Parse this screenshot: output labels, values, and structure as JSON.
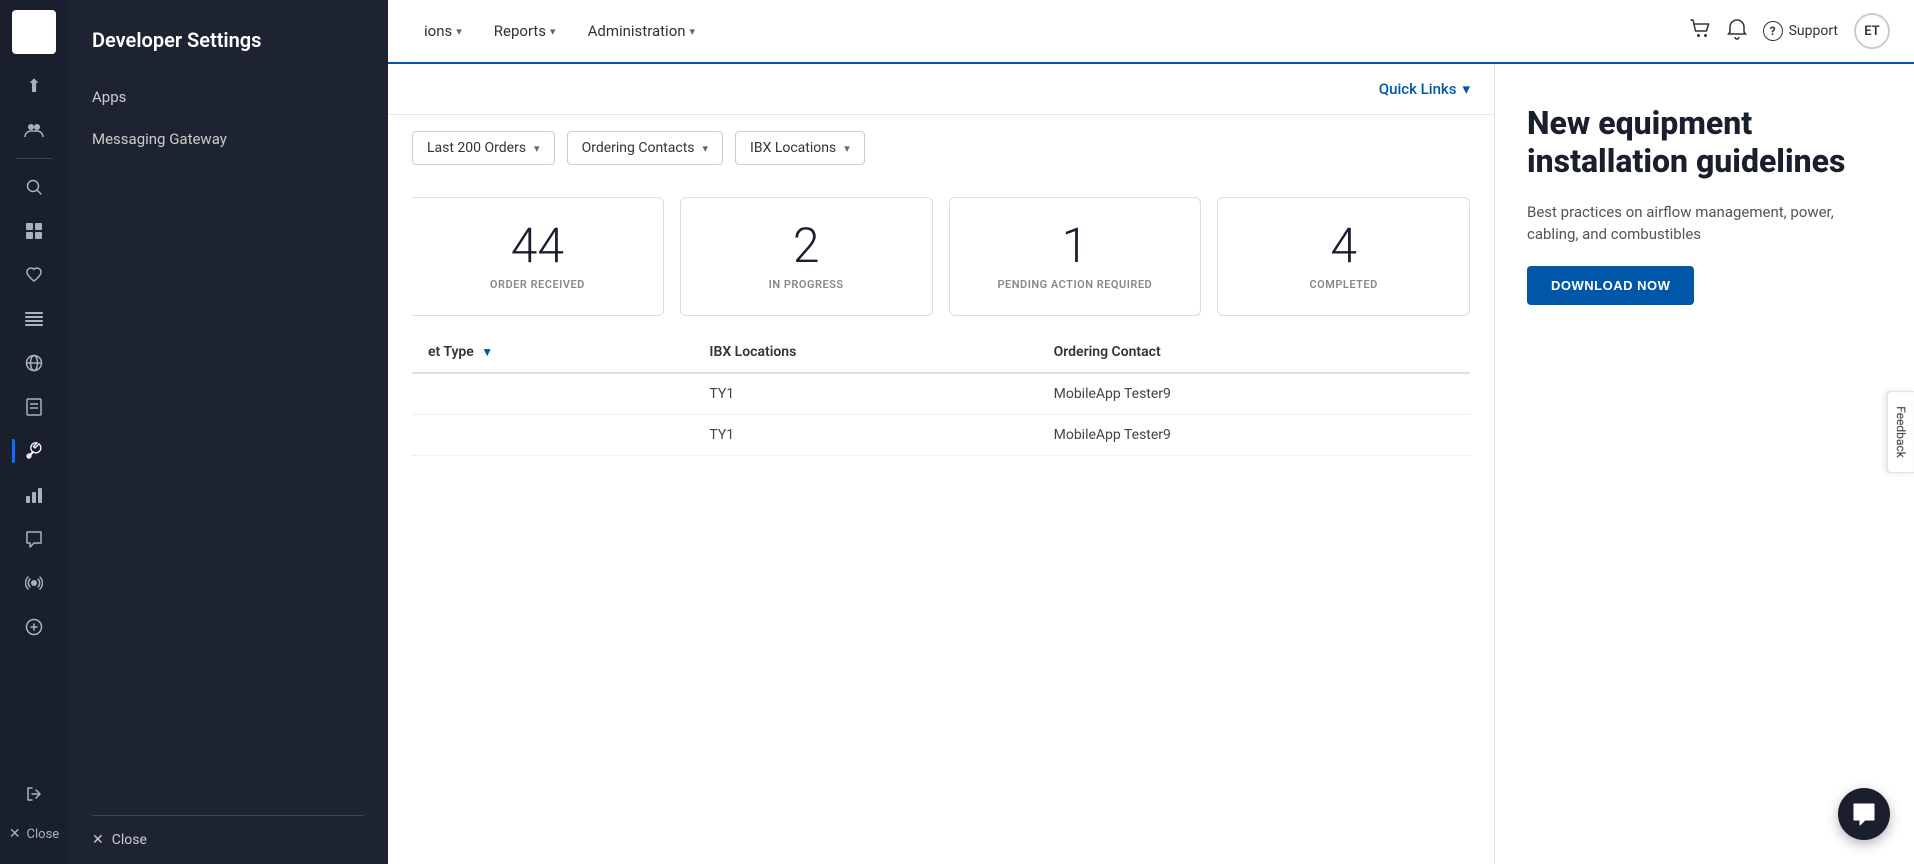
{
  "app": {
    "logo_text": "||||",
    "title": "Developer Settings"
  },
  "left_nav": {
    "icons": [
      {
        "name": "upload-icon",
        "symbol": "⬆",
        "active": false
      },
      {
        "name": "users-icon",
        "symbol": "👥",
        "active": false
      },
      {
        "name": "search-icon",
        "symbol": "🔍",
        "active": false
      },
      {
        "name": "table-icon",
        "symbol": "▦",
        "active": false
      },
      {
        "name": "health-icon",
        "symbol": "♡",
        "active": false
      },
      {
        "name": "columns-icon",
        "symbol": "☰",
        "active": false
      },
      {
        "name": "globe-icon",
        "symbol": "🌐",
        "active": false
      },
      {
        "name": "book-icon",
        "symbol": "📋",
        "active": false
      },
      {
        "name": "tools-icon",
        "symbol": "✂",
        "active": true
      },
      {
        "name": "chart-icon",
        "symbol": "📊",
        "active": false
      },
      {
        "name": "chat-icon",
        "symbol": "💬",
        "active": false
      },
      {
        "name": "broadcast-icon",
        "symbol": "📡",
        "active": false
      },
      {
        "name": "profile-icon",
        "symbol": "⊕",
        "active": false
      },
      {
        "name": "arrow-right-icon",
        "symbol": "→",
        "active": false
      }
    ],
    "close_label": "Close"
  },
  "dev_settings": {
    "title": "Developer Settings",
    "menu_items": [
      {
        "label": "Apps",
        "id": "apps"
      },
      {
        "label": "Messaging Gateway",
        "id": "messaging-gateway"
      }
    ]
  },
  "header": {
    "nav_items": [
      {
        "label": "ions",
        "has_dropdown": true
      },
      {
        "label": "Reports",
        "has_dropdown": true
      },
      {
        "label": "Administration",
        "has_dropdown": true
      }
    ],
    "actions": {
      "cart_icon": "🛒",
      "bell_icon": "🔔",
      "help_icon": "?",
      "support_label": "Support",
      "avatar_initials": "ET"
    }
  },
  "quick_links": {
    "label": "Quick Links",
    "chevron": "▾"
  },
  "filters": {
    "options": [
      {
        "label": "Last 200 Orders",
        "id": "last-200"
      },
      {
        "label": "Ordering Contacts",
        "id": "ordering-contacts"
      },
      {
        "label": "IBX Locations",
        "id": "ibx-locations"
      }
    ]
  },
  "stats": {
    "title": "Ordering Contacts",
    "cards": [
      {
        "number": "44",
        "label": "ORDER RECEIVED",
        "partial": true
      },
      {
        "number": "2",
        "label": "IN PROGRESS"
      },
      {
        "number": "1",
        "label": "PENDING ACTION REQUIRED"
      },
      {
        "number": "4",
        "label": "COMPLETED"
      }
    ]
  },
  "table": {
    "columns": [
      {
        "label": "et Type",
        "sortable": true
      },
      {
        "label": "IBX Locations",
        "sortable": false
      },
      {
        "label": "Ordering Contact",
        "sortable": false
      }
    ],
    "rows": [
      {
        "type": "",
        "ibx": "TY1",
        "contact": "MobileApp Tester9"
      },
      {
        "type": "",
        "ibx": "TY1",
        "contact": "MobileApp Tester9"
      }
    ]
  },
  "promo": {
    "title": "New equipment installation guidelines",
    "description": "Best practices on airflow management, power, cabling, and combustibles",
    "download_label": "DOWNLOAD NOW"
  },
  "feedback": {
    "label": "Feedback"
  },
  "chat": {
    "icon": "💬"
  }
}
